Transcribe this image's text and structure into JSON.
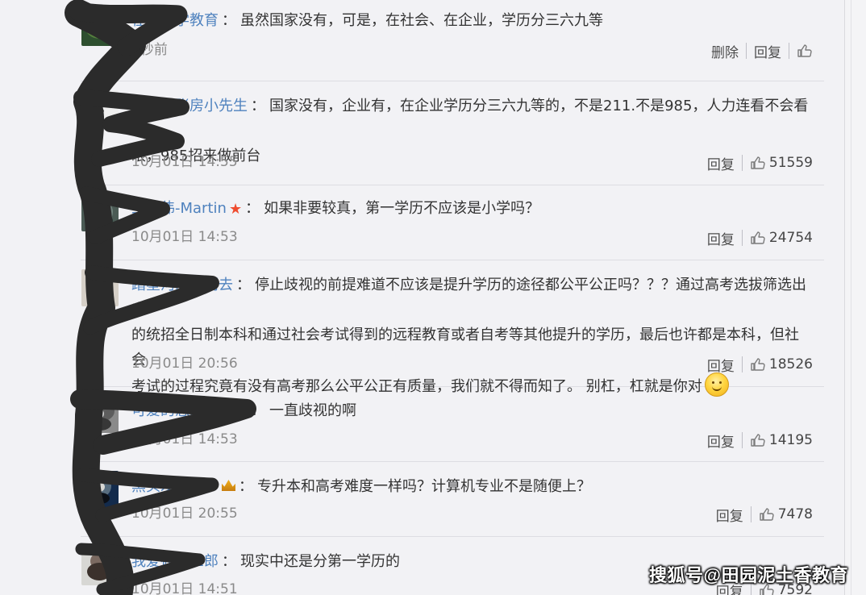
{
  "comments": [
    {
      "username": "在家上学教育",
      "line1": "虽然国家没有，可是，在社会、在企业，学历分三六九等",
      "line2": "",
      "line3": "",
      "timestamp": "0秒前",
      "delete_label": "删除",
      "reply_label": "回复",
      "like_count": ""
    },
    {
      "username": "茶馆的账房小先生",
      "line1": "国家没有，企业有，在企业学历分三六九等的，不是211.不是985，人力连看不会看一",
      "line2": "眼，985招来做前台",
      "line3": "",
      "timestamp": "10月01日 14:55",
      "reply_label": "回复",
      "like_count": "51559"
    },
    {
      "username": "王雅伟-Martin",
      "line1": "如果非要较真，第一学历不应该是小学吗？",
      "line2": "",
      "line3": "",
      "timestamp": "10月01日 14:53",
      "reply_label": "回复",
      "like_count": "24754"
    },
    {
      "username": "踏星河向梦而去",
      "line1": "停止歧视的前提难道不应该是提升学历的途径都公平公正吗？？？通过高考选拔筛选出来",
      "line2": "的统招全日制本科和通过社会考试得到的远程教育或者自考等其他提升的学历，最后也许都是本科，但社会",
      "line3": "考试的过程究竟有没有高考那么公平公正有质量，我们就不得而知了。 别杠，杠就是你对",
      "timestamp": "10月01日 20:56",
      "reply_label": "回复",
      "like_count": "18526"
    },
    {
      "username": "可爱的悠悠的小窝",
      "line1": "一直歧视的啊",
      "line2": "",
      "line3": "",
      "timestamp": "10月01日 14:53",
      "reply_label": "回复",
      "like_count": "14195"
    },
    {
      "username": "黑头发老爷爷",
      "line1": "专升本和高考难度一样吗？计算机专业不是随便上？",
      "line2": "",
      "line3": "",
      "timestamp": "10月01日 20:55",
      "reply_label": "回复",
      "like_count": "7478"
    },
    {
      "username": "我爱筱田三郎",
      "line1": "现实中还是分第一学历的",
      "line2": "",
      "line3": "",
      "timestamp": "10月01日 14:51",
      "reply_label": "回复",
      "like_count": "7592"
    }
  ],
  "watermark": "搜狐号@田园泥土香教育",
  "icons": {
    "like": "thumbs-up-icon",
    "star": "star-icon",
    "crown": "crown-icon",
    "emoji": "smile-emoji-icon"
  },
  "colors": {
    "background": "#f2f2f5",
    "username": "#4f82be",
    "timestamp": "#8a8a8a",
    "divider": "#dddde2",
    "redaction": "#2b2b2b"
  }
}
